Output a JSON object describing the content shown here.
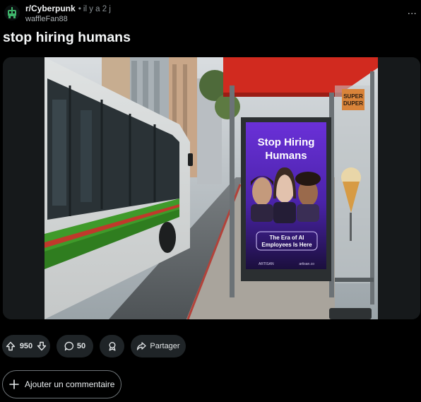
{
  "post": {
    "subreddit": "r/Cyberpunk",
    "separator": "•",
    "time": "il y a 2 j",
    "author": "waffleFan88",
    "title": "stop hiring humans"
  },
  "menu": {
    "more_label": "..."
  },
  "media": {
    "billboard": {
      "headline_line1": "Stop Hiring",
      "headline_line2": "Humans",
      "tagline_line1": "The Era of AI",
      "tagline_line2": "Employees Is Here",
      "brand": "ARTISAN",
      "url": "artisan.co"
    },
    "shop_sign": {
      "line1": "SUPER",
      "line2": "DUPER"
    }
  },
  "actions": {
    "upvotes": "950",
    "comments": "50",
    "share_label": "Partager"
  },
  "comment_box": {
    "label": "Ajouter un commentaire"
  },
  "colors": {
    "background": "#000000",
    "pill_background": "#1f2427",
    "bus_stop_red": "#d12a1f",
    "billboard_purple": "#5b2cc9",
    "bus_green": "#3f9a2a"
  },
  "icons": [
    "snoo-icon",
    "upvote-icon",
    "downvote-icon",
    "comment-icon",
    "award-icon",
    "share-icon",
    "plus-icon",
    "more-icon"
  ]
}
